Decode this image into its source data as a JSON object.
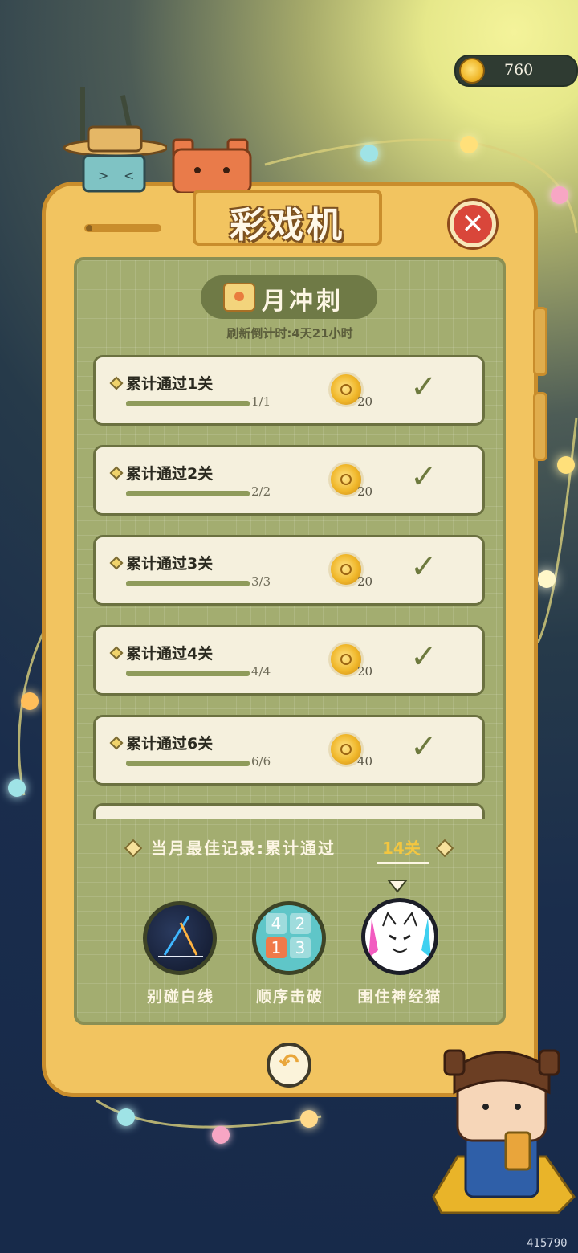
{
  "hud": {
    "coins": "760"
  },
  "dialog": {
    "title": "彩戏机",
    "close_symbol": "✕",
    "subtitle": "月冲刺",
    "countdown": "刷新倒计时:4天21小时"
  },
  "tasks": [
    {
      "label": "累计通过1关",
      "progress": "1/1",
      "reward": "20",
      "check": "✓"
    },
    {
      "label": "累计通过2关",
      "progress": "2/2",
      "reward": "20",
      "check": "✓"
    },
    {
      "label": "累计通过3关",
      "progress": "3/3",
      "reward": "20",
      "check": "✓"
    },
    {
      "label": "累计通过4关",
      "progress": "4/4",
      "reward": "20",
      "check": "✓"
    },
    {
      "label": "累计通过6关",
      "progress": "6/6",
      "reward": "40",
      "check": "✓"
    }
  ],
  "best": {
    "label": "当月最佳记录:累计通过",
    "value": "14关"
  },
  "games": [
    {
      "name": "别碰白线"
    },
    {
      "name": "顺序击破",
      "tiles": [
        "4",
        "2",
        "1",
        "3"
      ]
    },
    {
      "name": "围住神经猫"
    }
  ],
  "back_symbol": "↶",
  "watermark": "415790",
  "colors": {
    "panel": "#f2c460",
    "screen": "#a3ad70",
    "close": "#d9463a",
    "accent_gold": "#f3c640"
  }
}
